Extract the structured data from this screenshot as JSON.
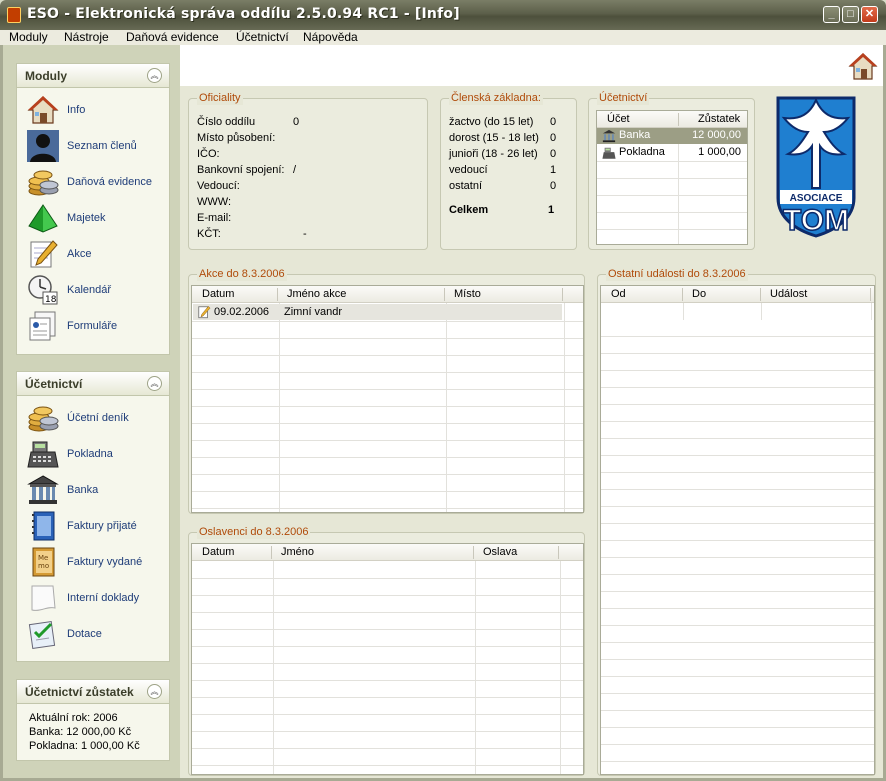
{
  "window": {
    "title": "ESO - Elektronická správa oddílu 2.5.0.94 RC1 - [Info]",
    "minimize": "_",
    "maximize": "□",
    "close": "✕"
  },
  "menu": [
    "Moduly",
    "Nástroje",
    "Daňová evidence",
    "Účetnictví",
    "Nápověda"
  ],
  "moduly": {
    "title": "Moduly",
    "items": [
      {
        "label": "Info",
        "icon": "house-icon"
      },
      {
        "label": "Seznam členů",
        "icon": "person-silhouette-icon"
      },
      {
        "label": "Daňová evidence",
        "icon": "coins-stack-icon"
      },
      {
        "label": "Majetek",
        "icon": "green-pyramid-icon"
      },
      {
        "label": "Akce",
        "icon": "notepad-pencil-icon"
      },
      {
        "label": "Kalendář",
        "icon": "clock-calendar-icon"
      },
      {
        "label": "Formuláře",
        "icon": "forms-icon"
      }
    ]
  },
  "ucetnictvi_nav": {
    "title": "Účetnictví",
    "items": [
      {
        "label": "Účetní deník",
        "icon": "coins-stack-icon"
      },
      {
        "label": "Pokladna",
        "icon": "cash-register-icon"
      },
      {
        "label": "Banka",
        "icon": "bank-building-icon"
      },
      {
        "label": "Faktury přijaté",
        "icon": "blue-notebook-icon"
      },
      {
        "label": "Faktury vydané",
        "icon": "memo-book-icon"
      },
      {
        "label": "Interní doklady",
        "icon": "blank-page-icon"
      },
      {
        "label": "Dotace",
        "icon": "checklist-icon"
      }
    ]
  },
  "zustatek": {
    "title": "Účetnictví zůstatek",
    "lines": [
      "Aktuální rok: 2006",
      "Banka: 12 000,00 Kč",
      "Pokladna: 1 000,00 Kč"
    ]
  },
  "oficiality": {
    "title": "Oficiality",
    "rows": [
      {
        "label": "Číslo oddílu",
        "value": "0"
      },
      {
        "label": "Místo působení:",
        "value": ""
      },
      {
        "label": "IČO:",
        "value": ""
      },
      {
        "label": "Bankovní spojení:",
        "value": "/"
      },
      {
        "label": "Vedoucí:",
        "value": ""
      },
      {
        "label": "WWW:",
        "value": ""
      },
      {
        "label": "E-mail:",
        "value": ""
      },
      {
        "label": "KČT:",
        "value": "-"
      }
    ]
  },
  "clenska": {
    "title": "Členská základna:",
    "rows": [
      {
        "label": "žactvo (do 15 let)",
        "value": "0"
      },
      {
        "label": "dorost (15 - 18 let)",
        "value": "0"
      },
      {
        "label": "junioři (18 - 26 let)",
        "value": "0"
      },
      {
        "label": "vedoucí",
        "value": "1"
      },
      {
        "label": "ostatní",
        "value": "0"
      }
    ],
    "total_label": "Celkem",
    "total_value": "1"
  },
  "ucetnictvi_box": {
    "title": "Účetnictví",
    "headers": [
      "Účet",
      "Zůstatek"
    ],
    "rows": [
      {
        "account": "Banka",
        "balance": "12 000,00",
        "icon": "bank-building-icon"
      },
      {
        "account": "Pokladna",
        "balance": "1 000,00",
        "icon": "cash-register-icon"
      }
    ]
  },
  "logo": {
    "top": "ASOCIACE",
    "bottom": "TOM"
  },
  "akce": {
    "title": "Akce do 8.3.2006",
    "headers": [
      "Datum",
      "Jméno akce",
      "Místo"
    ],
    "rows": [
      {
        "date": "09.02.2006",
        "name": "Zimní vandr",
        "place": ""
      }
    ]
  },
  "ostatni": {
    "title": "Ostatní události do 8.3.2006",
    "headers": [
      "Od",
      "Do",
      "Událost"
    ]
  },
  "oslavenci": {
    "title": "Oslavenci do 8.3.2006",
    "headers": [
      "Datum",
      "Jméno",
      "Oslava"
    ]
  },
  "colors": {
    "accent_title": "#b04b0a",
    "nav_text": "#1e3c78",
    "titlebar": "#5c5f4a"
  }
}
